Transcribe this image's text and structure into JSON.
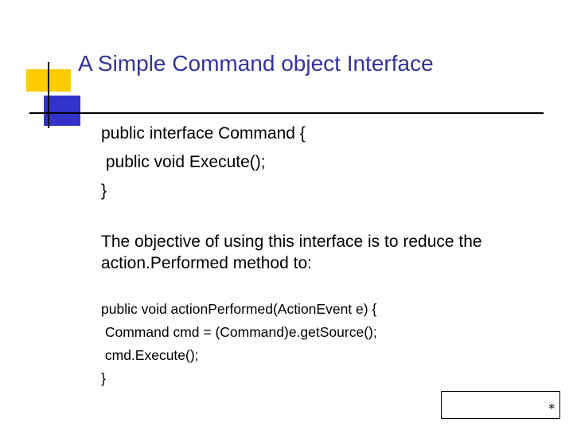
{
  "slide": {
    "title": "A Simple Command object Interface",
    "code_block_1": [
      "public interface Command {",
      " public void Execute();",
      "}"
    ],
    "paragraph": [
      "The objective of using this interface is to reduce the",
      "action.Performed method to:"
    ],
    "code_block_2": [
      "public void actionPerformed(ActionEvent e) {",
      " Command cmd = (Command)e.getSource();",
      " cmd.Execute();",
      "}"
    ],
    "footer_mark": "*"
  },
  "colors": {
    "title": "#333399",
    "accent_yellow": "#ffcc00",
    "accent_blue": "#3333cc"
  }
}
